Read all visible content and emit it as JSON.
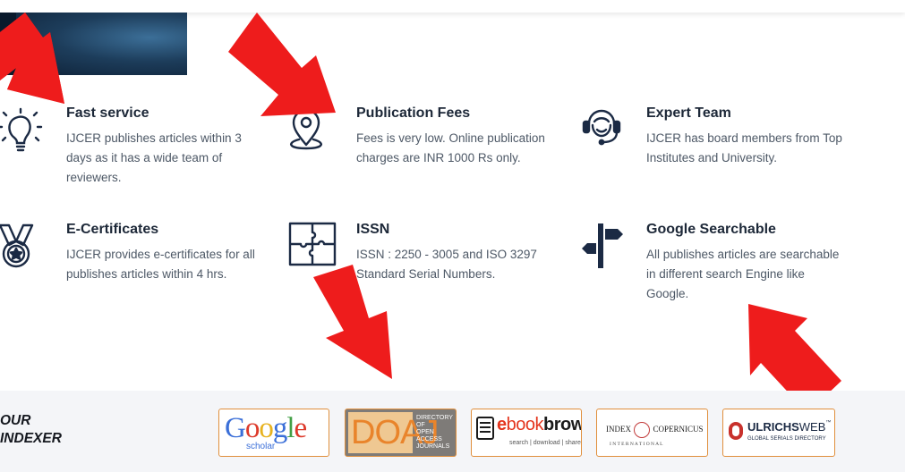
{
  "features": [
    {
      "title": "Fast service",
      "text": "IJCER publishes articles within 3 days as it has a wide team of reviewers.",
      "icon": "lightbulb-icon"
    },
    {
      "title": "Publication Fees",
      "text": "Fees is very low. Online publication charges are INR 1000 Rs only.",
      "icon": "location-pin-icon"
    },
    {
      "title": "Expert Team",
      "text": "IJCER has board members from Top Institutes and University.",
      "icon": "support-headset-icon"
    },
    {
      "title": "E-Certificates",
      "text": "IJCER provides e-certificates for all publishes articles within 4 hrs.",
      "icon": "medal-icon"
    },
    {
      "title": "ISSN",
      "text": "ISSN : 2250 - 3005 and ISO 3297 Standard Serial Numbers.",
      "icon": "puzzle-icon"
    },
    {
      "title": "Google Searchable",
      "text": "All publishes articles are searchable in different search Engine like Google.",
      "icon": "signpost-icon"
    }
  ],
  "indexer": {
    "title_line1": "OUR",
    "title_line2": "INDEXER",
    "logos": [
      {
        "name": "Google scholar",
        "word": "Google",
        "sub": "scholar"
      },
      {
        "name": "DOAJ",
        "word": "DOAJ",
        "sub1": "DIRECTORY OF",
        "sub2": "OPEN ACCESS",
        "sub3": "JOURNALS"
      },
      {
        "name": "ebookbrowse",
        "word_e": "e",
        "word_book": "book",
        "word_browse": "browse",
        "sub": "search | download | share"
      },
      {
        "name": "Index Copernicus",
        "word1": "INDEX",
        "word2": "COPERNICUS",
        "sub": "I N T E R N A T I O N A L"
      },
      {
        "name": "Ulrichsweb",
        "word1": "ULRICHS",
        "word2": "WEB",
        "tm": "™",
        "sub": "GLOBAL SERIALS DIRECTORY"
      }
    ]
  },
  "colors": {
    "accent": "#ee1c1c",
    "icon": "#1b2a44",
    "logo_border": "#e08f3c"
  }
}
